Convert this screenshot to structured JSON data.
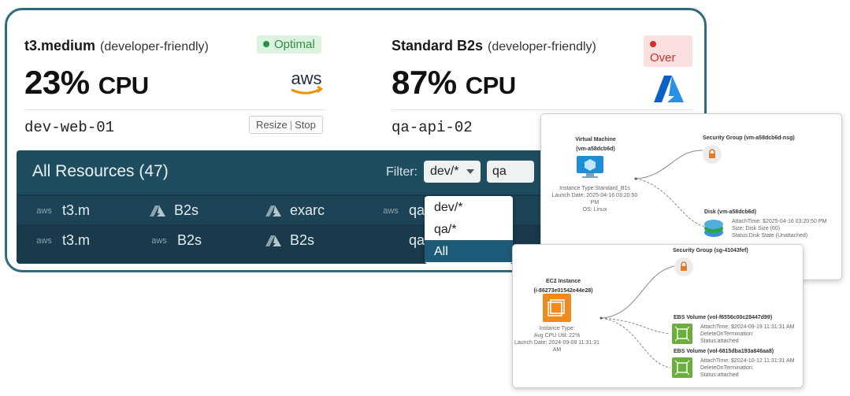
{
  "vm_cards": [
    {
      "name": "t3.medium",
      "tag": "(developer-friendly)",
      "status": "Optimal",
      "cpu_value": "23%",
      "cpu_unit": "CPU",
      "provider": "aws",
      "hostname": "dev-web-01",
      "actions": [
        "Resize",
        "Stop"
      ],
      "status_color": "#2f8e44"
    },
    {
      "name": "Standard B2s",
      "tag": "(developer-friendly)",
      "status": "Over",
      "cpu_value": "87%",
      "cpu_unit": "CPU",
      "provider": "azure",
      "hostname": "qa-api-02",
      "status_color": "#d0302a"
    }
  ],
  "resources": {
    "title": "All Resources (47)",
    "filter_label": "Filter:",
    "filter_value": "dev/*",
    "filter_second": "qa",
    "dropdown_options": [
      "dev/*",
      "qa/*",
      "All"
    ],
    "dropdown_selected": "All",
    "rows": [
      [
        {
          "provider": "aws",
          "label": "t3.m"
        },
        {
          "provider": "azure",
          "label": "B2s"
        },
        {
          "provider": "azure",
          "label": "exarc"
        },
        {
          "provider": "aws",
          "label": "qa"
        }
      ],
      [
        {
          "provider": "aws",
          "label": "t3.m"
        },
        {
          "provider": "aws",
          "label": "B2s"
        },
        {
          "provider": "azure",
          "label": "B2s"
        },
        {
          "provider": "none",
          "label": "qa"
        }
      ]
    ]
  },
  "diagram_azure": {
    "vm_title": "Virtual Machine",
    "vm_id": "(vm-a58dcb6d)",
    "vm_details": [
      "Instance Type:Standard_B1s",
      "Launch Date: 2025-04-16 03:20:50 PM",
      "OS: Linux"
    ],
    "sg_title": "Security Group (vm-a58dcb6d-nsg)",
    "disk_title": "Disk (vm-a58dcb6d)",
    "disk_details": [
      "AttachTime: $2025-04-16 03:20:50 PM",
      "Size: Disk Size (60)",
      "Status:Disk State (Unattached)"
    ]
  },
  "diagram_aws": {
    "ec2_title": "EC2 Instance",
    "ec2_id": "(i-86273e01542e44e28)",
    "ec2_details": [
      "Instance Type:",
      "Avg CPU Util: 22%",
      "Launch Date: 2024-09-08 11:31:31 AM"
    ],
    "sg_title": "Security Group (sg-41043fef)",
    "ebs1_title": "EBS Volume (vol-f6556c00c28447d99)",
    "ebs1_details": [
      "AttachTime: $2024-09-19 11:31:31 AM",
      "DeleteOnTermination:",
      "Status:attached"
    ],
    "ebs2_title": "EBS Volume (vol-6815dba193a846aa8)",
    "ebs2_details": [
      "AttachTime: $2024-10-12 11:31:31 AM",
      "DeleteOnTermination:",
      "Status:attached"
    ]
  }
}
